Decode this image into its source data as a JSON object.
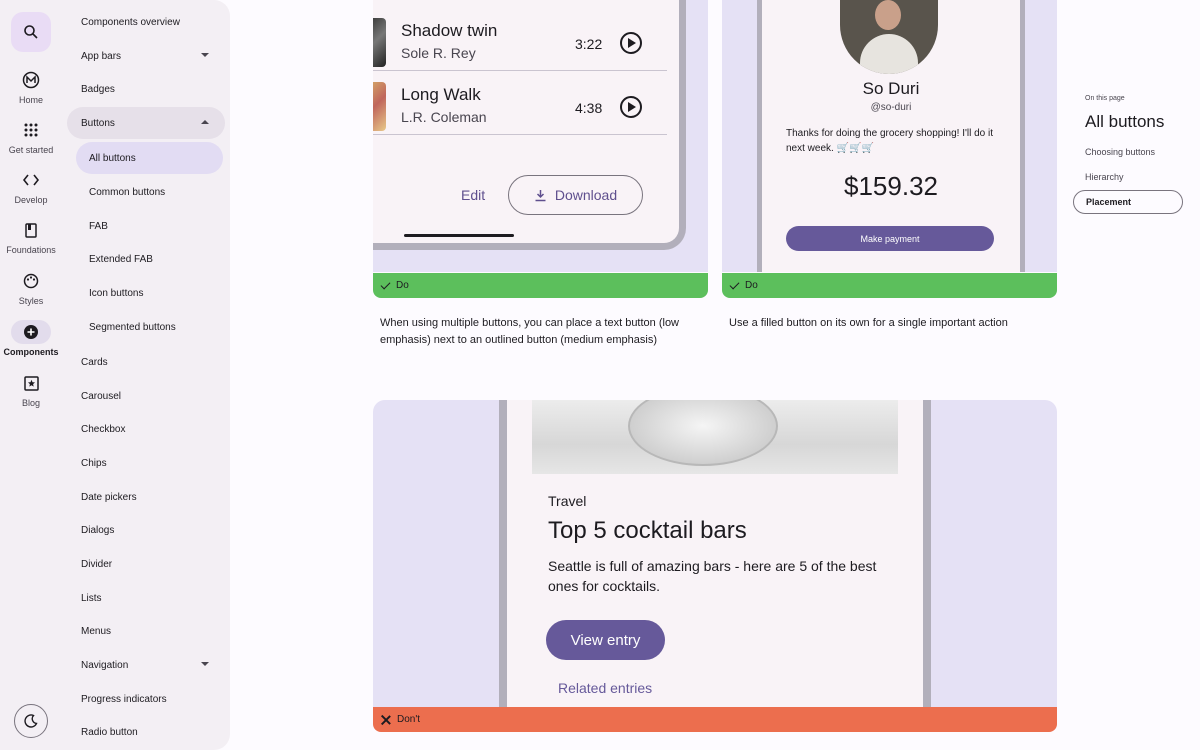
{
  "rail": {
    "items": [
      {
        "label": "Home",
        "icon": "material-logo-icon"
      },
      {
        "label": "Get started",
        "icon": "grid-icon"
      },
      {
        "label": "Develop",
        "icon": "code-icon"
      },
      {
        "label": "Foundations",
        "icon": "book-icon"
      },
      {
        "label": "Styles",
        "icon": "palette-icon"
      },
      {
        "label": "Components",
        "icon": "add-circle-icon",
        "active": true
      },
      {
        "label": "Blog",
        "icon": "star-box-icon"
      }
    ]
  },
  "sidelist": {
    "items": [
      "Components overview",
      "App bars",
      "Badges",
      "Buttons",
      "All buttons",
      "Common buttons",
      "FAB",
      "Extended FAB",
      "Icon buttons",
      "Segmented buttons",
      "Cards",
      "Carousel",
      "Checkbox",
      "Chips",
      "Date pickers",
      "Dialogs",
      "Divider",
      "Lists",
      "Menus",
      "Navigation",
      "Progress indicators",
      "Radio button"
    ]
  },
  "example1": {
    "tracks": [
      {
        "title": "Shadow twin",
        "artist": "Sole R. Rey",
        "time": "3:22"
      },
      {
        "title": "Long Walk",
        "artist": "L.R. Coleman",
        "time": "4:38"
      }
    ],
    "edit_label": "Edit",
    "download_label": "Download",
    "badge": "Do",
    "caption": "When using multiple buttons, you can place a text button (low emphasis) next to an outlined button (medium emphasis)"
  },
  "example2": {
    "name": "So Duri",
    "handle": "@so-duri",
    "note": "Thanks for doing the grocery shopping! I'll do it next week. 🛒🛒🛒",
    "amount": "$159.32",
    "button": "Make payment",
    "badge": "Do",
    "caption": "Use a filled button on its own for a single important action"
  },
  "example3": {
    "kicker": "Travel",
    "title": "Top 5 cocktail bars",
    "body": "Seattle is full of amazing bars - here are 5 of the best ones for cocktails.",
    "button": "View entry",
    "link": "Related entries",
    "badge": "Don't"
  },
  "toc": {
    "label": "On this page",
    "title": "All buttons",
    "items": [
      "Choosing buttons",
      "Hierarchy",
      "Placement"
    ]
  },
  "colors": {
    "primary": "#66599a",
    "do": "#5cbf5c",
    "dont": "#ec6e4e",
    "card_bg": "#e5e1f5"
  }
}
